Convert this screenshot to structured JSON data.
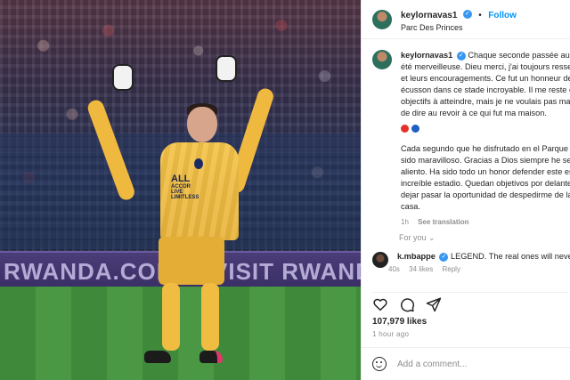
{
  "photo": {
    "board_text": "RWANDA.COM",
    "board_text_2": "VISIT RWANDA",
    "jersey_sponsor": "ALL",
    "jersey_sponsor_sub": "ACCOR LIVE LIMITLESS"
  },
  "post": {
    "username": "keylornavas1",
    "follow_label": "Follow",
    "location": "Parc Des Princes",
    "caption_lines": [
      "Chaque seconde passée au Parc",
      "été merveilleuse. Dieu merci, j'ai toujours ressen",
      "et leurs encouragements. Ce fut un honneur de",
      "écusson dans ce stade incroyable. Il me reste en",
      "objectifs à atteindre, mais je ne voulais pas man",
      "de dire au revoir à ce qui fut ma maison."
    ],
    "caption_lines_es": [
      "Cada segundo que he disfrutado en el Parque d",
      "sido maravilloso. Gracias a Dios siempre he sent",
      "aliento. Ha sido todo un honor defender este es",
      "increíble estadio. Quedan objetivos por delante",
      "dejar pasar la oportunidad de despedirme de la",
      "casa."
    ],
    "time": "1h",
    "see_translation": "See translation",
    "for_you": "For you",
    "comment": {
      "username": "k.mbappe",
      "text": "LEGEND. The real ones will never fo",
      "time": "40s",
      "likes": "34 likes",
      "reply": "Reply"
    },
    "likes_count": "107,979 likes",
    "posted_ago": "1 hour ago",
    "add_comment_placeholder": "Add a comment...",
    "colors": {
      "link": "#0095f6",
      "muted": "#8e8e8e",
      "text": "#262626",
      "flag_red": "#e4322b",
      "flag_blue": "#1d5fc4"
    }
  }
}
